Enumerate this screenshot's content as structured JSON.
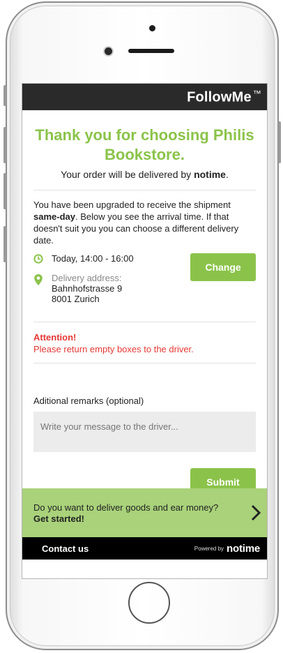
{
  "app": {
    "brand": "FollowMe",
    "trademark": "™"
  },
  "hero": {
    "title": "Thank you for choosing Philis Bookstore.",
    "subline_prefix": "Your order will be delivered by ",
    "subline_courier": "notime",
    "subline_suffix": "."
  },
  "upgrade": {
    "text_prefix": "You have been upgraded to receive the shipment ",
    "text_bold": "same-day",
    "text_suffix": ". Below you see the arrival time. If that doesn't suit you you can choose a different delivery date."
  },
  "delivery": {
    "time": "Today, 14:00 - 16:00",
    "address_label": "Delivery address:",
    "address_line1": "Bahnhofstrasse 9",
    "address_line2": "8001 Zurich",
    "change_label": "Change"
  },
  "attention": {
    "title": "Attention!",
    "text": "Please return empty boxes to the driver."
  },
  "remarks": {
    "label": "Aditional remarks (optional)",
    "placeholder": "Write your message to the driver...",
    "submit_label": "Submit"
  },
  "promo": {
    "question": "Do you want to deliver goods and ear money?",
    "cta": "Get started!"
  },
  "footer": {
    "contact": "Contact us",
    "powered_by": "Powered by",
    "logo": "notime"
  },
  "colors": {
    "accent": "#8bc34a",
    "promo_bg": "#a9d27a",
    "attention": "#e53935",
    "topbar": "#2a2a2a"
  },
  "icons": {
    "time": "clock-icon",
    "address": "location-pin-icon",
    "promo_arrow": "chevron-right-icon"
  }
}
